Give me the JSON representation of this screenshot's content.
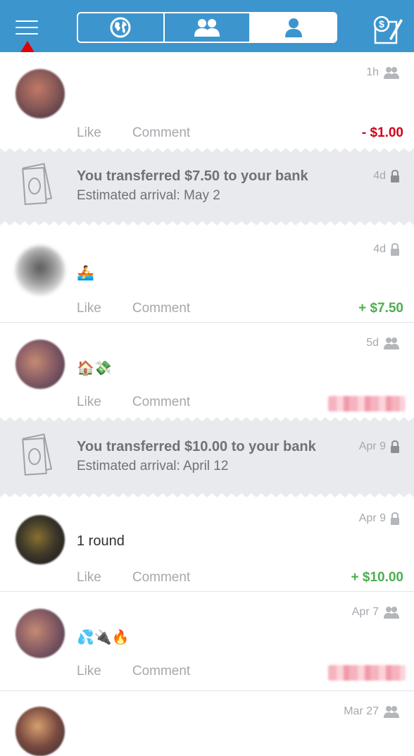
{
  "header": {
    "tabs": [
      {
        "name": "globe",
        "icon": "globe-icon",
        "active": false
      },
      {
        "name": "friends",
        "icon": "friends-icon",
        "active": false
      },
      {
        "name": "me",
        "icon": "person-icon",
        "active": true
      }
    ],
    "pay_icon": "pay-request-icon",
    "menu_icon": "hamburger-menu-icon",
    "accent": "#3d95ce"
  },
  "feed": {
    "like_label": "Like",
    "comment_label": "Comment",
    "items": [
      {
        "type": "story",
        "time": "1h",
        "privacy": "friends-icon",
        "note": "",
        "amount": "- $1.00",
        "amount_color": "#d0021b"
      },
      {
        "type": "transfer",
        "title": "You transferred $7.50 to your bank",
        "subtitle": "Estimated arrival: May 2",
        "time": "4d",
        "privacy": "lock-icon"
      },
      {
        "type": "story",
        "time": "4d",
        "privacy": "lock-icon",
        "note": "🚣",
        "amount": "+ $7.50",
        "amount_color": "#4caf50"
      },
      {
        "type": "story",
        "time": "5d",
        "privacy": "friends-icon",
        "note": "🏠💸",
        "amount": "",
        "amount_blurred": true
      },
      {
        "type": "transfer",
        "title": "You transferred $10.00 to your bank",
        "subtitle": "Estimated arrival: April 12",
        "time": "Apr 9",
        "privacy": "lock-icon"
      },
      {
        "type": "story",
        "time": "Apr 9",
        "privacy": "lock-icon",
        "note": "1 round",
        "amount": "+ $10.00",
        "amount_color": "#4caf50"
      },
      {
        "type": "story",
        "time": "Apr 7",
        "privacy": "friends-icon",
        "note": "💦🔌🔥",
        "amount": "",
        "amount_blurred": true
      },
      {
        "type": "story",
        "time": "Mar 27",
        "privacy": "friends-icon",
        "note": "",
        "amount": ""
      }
    ]
  }
}
